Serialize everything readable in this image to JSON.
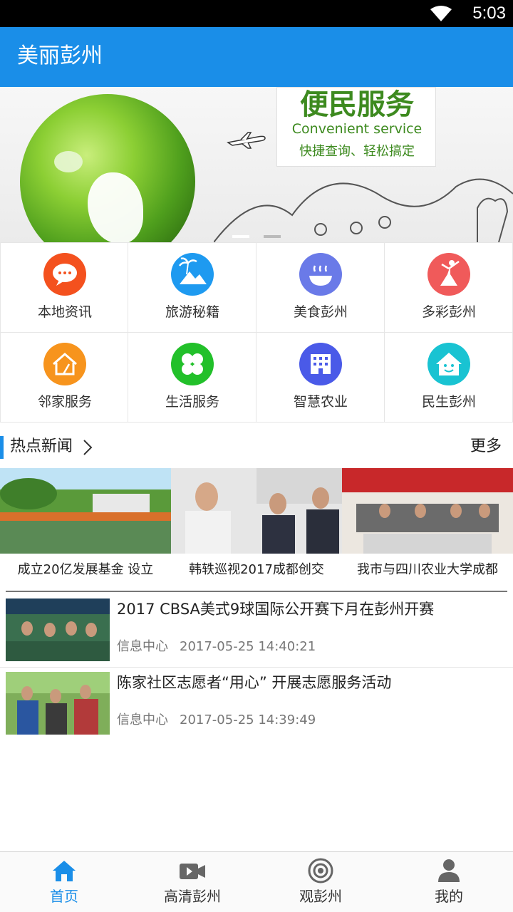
{
  "status_bar": {
    "time": "5:03"
  },
  "app_bar": {
    "title": "美丽彭州"
  },
  "banner": {
    "title": "便民服务",
    "subtitle": "Convenient service",
    "tagline": "快捷查询、轻松搞定"
  },
  "grid": {
    "items": [
      {
        "label": "本地资讯",
        "icon": "chat-bubbles-icon",
        "color": "#f4511e"
      },
      {
        "label": "旅游秘籍",
        "icon": "palm-mountain-icon",
        "color": "#1e9af0"
      },
      {
        "label": "美食彭州",
        "icon": "steaming-bowl-icon",
        "color": "#6a7ae8"
      },
      {
        "label": "多彩彭州",
        "icon": "dancer-icon",
        "color": "#f05a5a"
      },
      {
        "label": "邻家服务",
        "icon": "house-broom-icon",
        "color": "#f7941d"
      },
      {
        "label": "生活服务",
        "icon": "clover-icon",
        "color": "#22c02a"
      },
      {
        "label": "智慧农业",
        "icon": "building-icon",
        "color": "#4a5ae8"
      },
      {
        "label": "民生彭州",
        "icon": "smile-house-icon",
        "color": "#19c3d2"
      }
    ]
  },
  "hot_news": {
    "title": "热点新闻",
    "more": "更多"
  },
  "carousel": {
    "items": [
      {
        "caption": "成立20亿发展基金 设立"
      },
      {
        "caption": "韩轶巡视2017成都创交"
      },
      {
        "caption": "我市与四川农业大学成都"
      }
    ]
  },
  "news_list": {
    "items": [
      {
        "title": "2017 CBSA美式9球国际公开赛下月在彭州开赛",
        "source": "信息中心",
        "time": "2017-05-25 14:40:21"
      },
      {
        "title": "陈家社区志愿者“用心” 开展志愿服务活动",
        "source": "信息中心",
        "time": "2017-05-25 14:39:49"
      }
    ]
  },
  "bottom_nav": {
    "items": [
      {
        "label": "首页",
        "icon": "home-icon",
        "active": true
      },
      {
        "label": "高清彭州",
        "icon": "video-camera-icon",
        "active": false
      },
      {
        "label": "观彭州",
        "icon": "target-eye-icon",
        "active": false
      },
      {
        "label": "我的",
        "icon": "person-icon",
        "active": false
      }
    ]
  },
  "colors": {
    "primary": "#1a8ee8",
    "app_bar": "#1a8ee8",
    "status_bar": "#000000",
    "banner_green": "#3d8a1f"
  }
}
